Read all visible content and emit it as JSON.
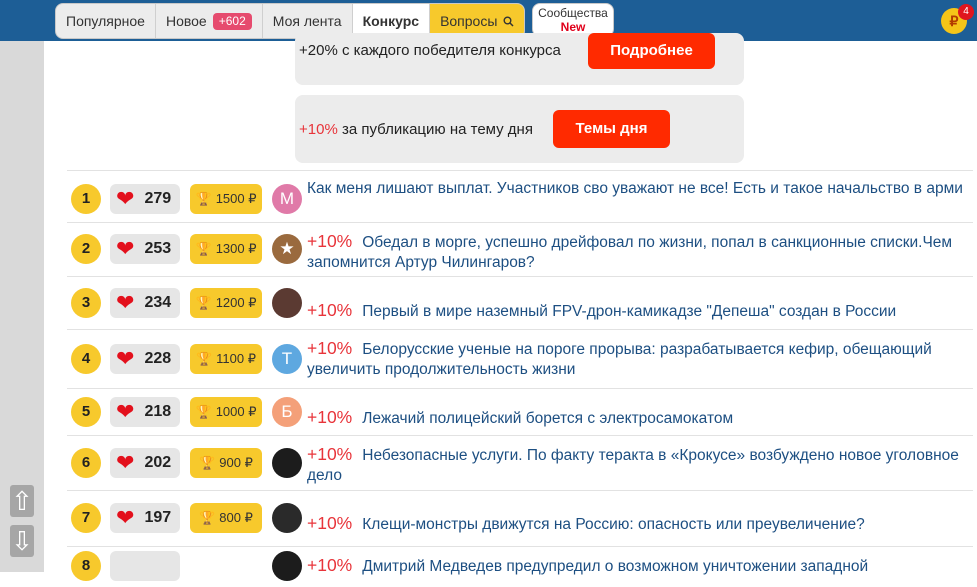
{
  "nav": {
    "tabs": [
      {
        "label": "Популярное"
      },
      {
        "label": "Новое",
        "badge": "+602"
      },
      {
        "label": "Моя лента"
      },
      {
        "label": "Конкурс"
      },
      {
        "label": "Вопросы"
      }
    ],
    "communities": {
      "label": "Сообщества",
      "badge": "New"
    },
    "coin": {
      "symbol": "₽",
      "count": "4"
    }
  },
  "promo": {
    "item1": {
      "text": "+20% с каждого победителя конкурса",
      "button": "Подробнее"
    },
    "item2": {
      "pct": "+10%",
      "text": "за публикацию на тему дня",
      "button": "Темы дня"
    }
  },
  "side_arrows": {
    "up": "⇧",
    "down": "⇩"
  },
  "rows": [
    {
      "rank": "1",
      "likes": "279",
      "prize": "1500 ₽",
      "bonus": "",
      "title": "Как меня лишают выплат. Участников сво уважают не все! Есть и такое начальство в арми",
      "avatar": "М",
      "avatar_color": "#e07aa8"
    },
    {
      "rank": "2",
      "likes": "253",
      "prize": "1300 ₽",
      "bonus": "+10%",
      "title": "Обедал в морге, успешно дрейфовал по жизни, попал в санкционные списки.Чем запомнится Артур Чилингаров?",
      "avatar": "★",
      "avatar_color": "#9a6a3e"
    },
    {
      "rank": "3",
      "likes": "234",
      "prize": "1200 ₽",
      "bonus": "+10%",
      "title": "Первый в мире наземный FPV-дрон-камикадзе \"Депеша\" создан в России",
      "avatar": "",
      "avatar_color": "#5b3a32"
    },
    {
      "rank": "4",
      "likes": "228",
      "prize": "1100 ₽",
      "bonus": "+10%",
      "title": "Белорусские ученые на пороге прорыва: разрабатывается кефир, обещающий увеличить продолжительность жизни",
      "avatar": "Т",
      "avatar_color": "#5ea8e0"
    },
    {
      "rank": "5",
      "likes": "218",
      "prize": "1000 ₽",
      "bonus": "+10%",
      "title": "Лежачий полицейский борется с электросамокатом",
      "avatar": "Б",
      "avatar_color": "#f4a079"
    },
    {
      "rank": "6",
      "likes": "202",
      "prize": "900 ₽",
      "bonus": "+10%",
      "title": "Небезопасные услуги. По факту теракта в «Крокусе» возбуждено новое уголовное дело",
      "avatar": "",
      "avatar_color": "#1c1c1c"
    },
    {
      "rank": "7",
      "likes": "197",
      "prize": "800 ₽",
      "bonus": "+10%",
      "title": "Клещи-монстры движутся на Россию: опасность или преувеличение?",
      "avatar": "",
      "avatar_color": "#2a2a2a"
    },
    {
      "rank": "8",
      "likes": "",
      "prize": "",
      "bonus": "+10%",
      "title": "Дмитрий Медведев предупредил о возможном уничтожении западной",
      "avatar": "",
      "avatar_color": "#1c1c1c"
    }
  ]
}
